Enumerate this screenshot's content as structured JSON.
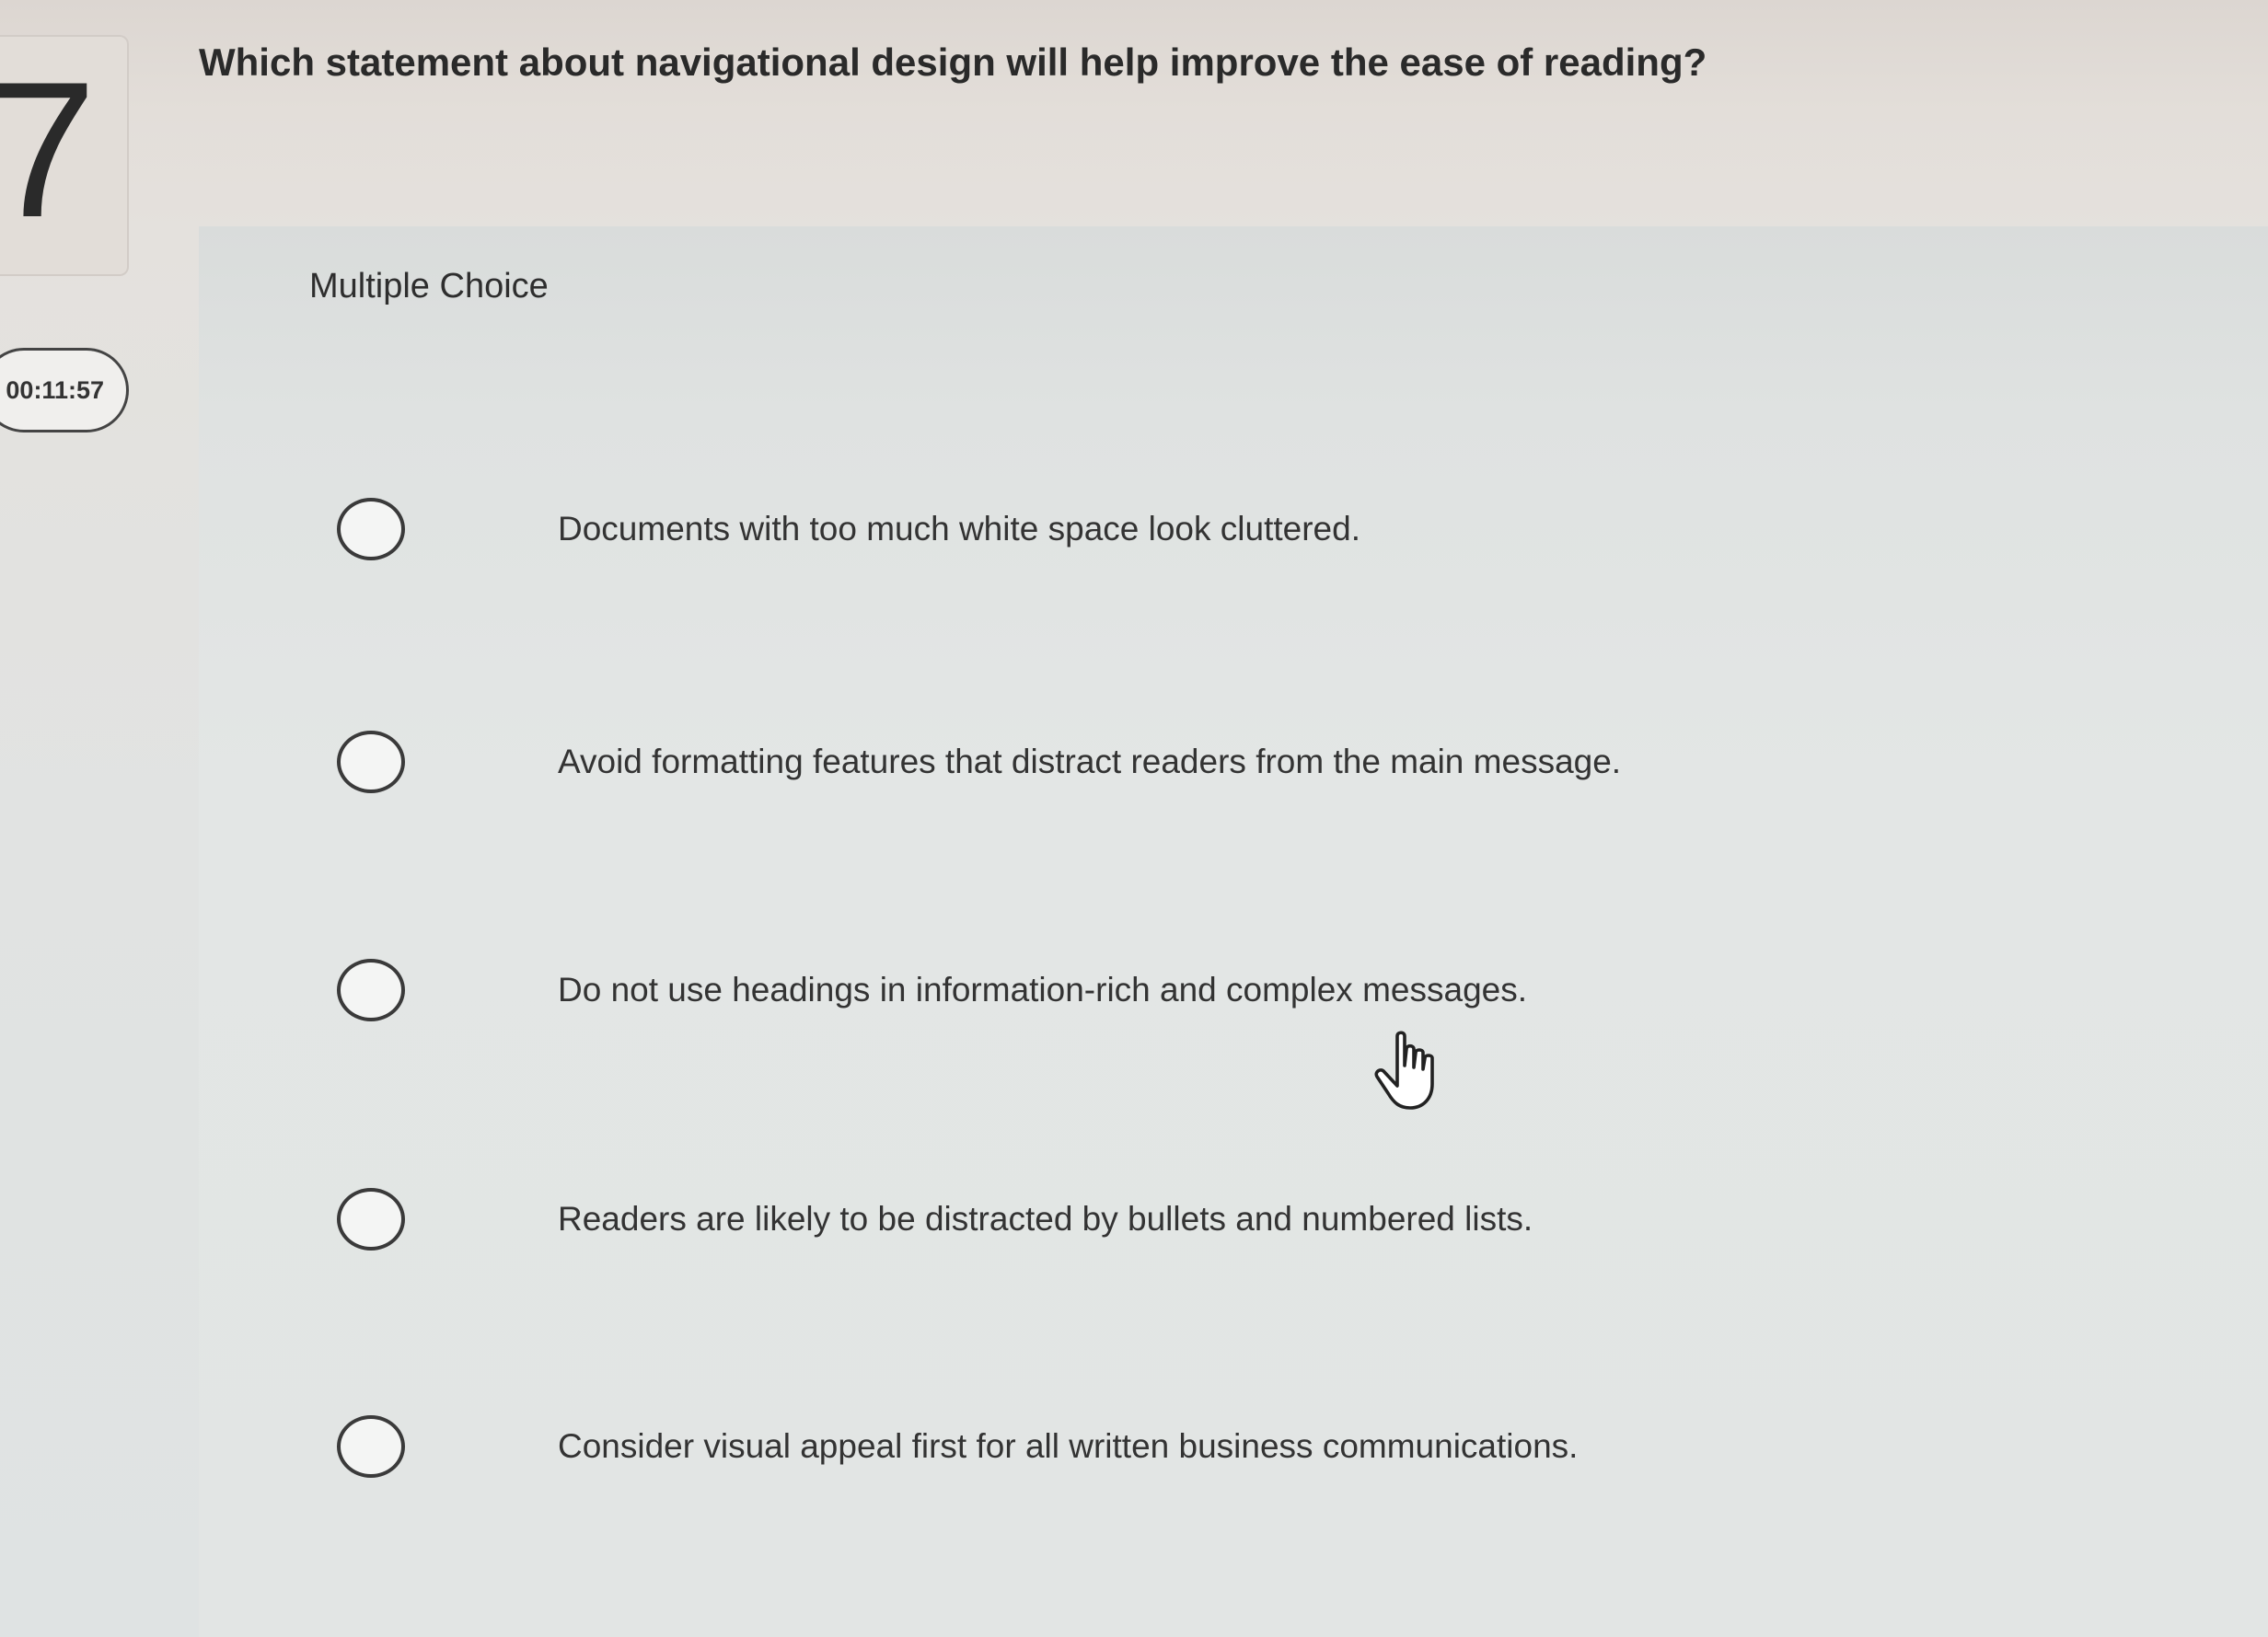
{
  "question_number": "7",
  "timer": "00:11:57",
  "question": "Which statement about navigational design will help improve the ease of reading?",
  "question_type": "Multiple Choice",
  "options": [
    {
      "label": "Documents with too much white space look cluttered.",
      "selected": false
    },
    {
      "label": "Avoid formatting features that distract readers from the main message.",
      "selected": false
    },
    {
      "label": "Do not use headings in information-rich and complex messages.",
      "selected": false
    },
    {
      "label": "Readers are likely to be distracted by bullets and numbered lists.",
      "selected": false
    },
    {
      "label": "Consider visual appeal first for all written business communications.",
      "selected": false
    }
  ],
  "cursor_icon": "hand-pointer-icon"
}
